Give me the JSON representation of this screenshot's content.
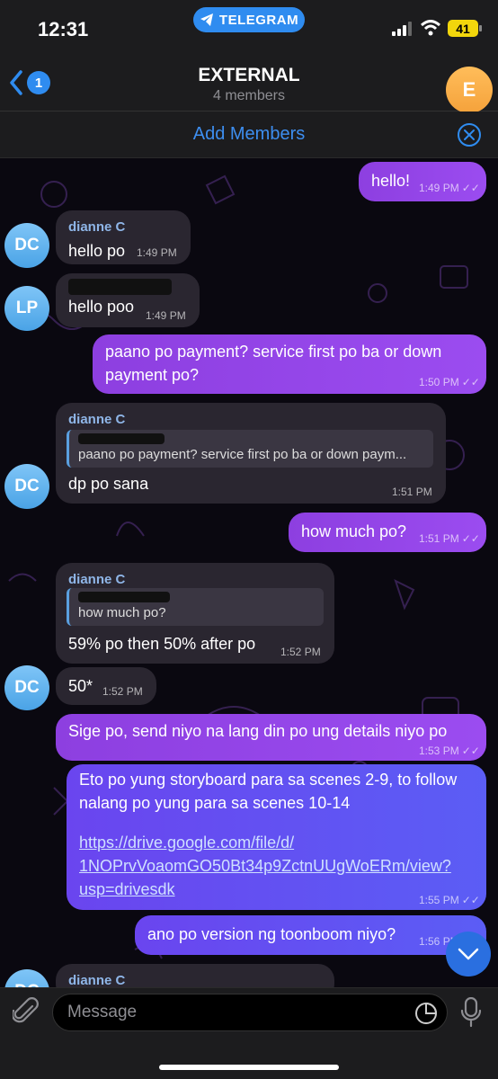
{
  "status_bar": {
    "time": "12:31",
    "app_pill": "TELEGRAM",
    "battery": "41"
  },
  "header": {
    "back_count": "1",
    "title": "EXTERNAL",
    "subtitle": "4 members",
    "avatar_letter": "E"
  },
  "add_members": {
    "label": "Add Members"
  },
  "messages": [
    {
      "text": "hello!",
      "time": "1:49 PM"
    },
    {
      "sender": "dianne C",
      "text": "hello po",
      "time": "1:49 PM",
      "avatar": "DC"
    },
    {
      "text": "hello poo",
      "time": "1:49 PM",
      "avatar": "LP"
    },
    {
      "text": "paano po payment? service first po ba or down payment po?",
      "time": "1:50 PM"
    },
    {
      "sender": "dianne C",
      "reply": "paano po payment? service first po ba or down paym...",
      "text": "dp po sana",
      "time": "1:51 PM",
      "avatar": "DC"
    },
    {
      "text": "how much po?",
      "time": "1:51 PM"
    },
    {
      "sender": "dianne C",
      "reply": "how much po?",
      "text": "59% po then 50% after po",
      "time": "1:52 PM"
    },
    {
      "text": "50*",
      "time": "1:52 PM",
      "avatar": "DC"
    },
    {
      "text": "Sige po, send niyo na lang din po ung details niyo po",
      "time": "1:53 PM"
    },
    {
      "text": "Eto po yung storyboard para sa scenes 2-9, to follow nalang po yung para sa scenes 10-14",
      "link": "https://drive.google.com/file/d/1NOPrvVoaomGO50Bt34p9ZctnUUgWoERm/view?usp=drivesdk",
      "link_lines": [
        "https://drive.google.com/file/d/",
        "1NOPrvVoaomGO50Bt34p9ZctnUUgWoERm/view?",
        "usp=drivesdk"
      ],
      "time": "1:55 PM"
    },
    {
      "text": "ano po version ng toonboom niyo?",
      "time": "1:56 PM"
    },
    {
      "sender": "dianne C",
      "avatar": "DC"
    }
  ],
  "input": {
    "placeholder": "Message"
  },
  "colors": {
    "accent": "#2f8cf0",
    "outgoing": "#9b4cf0",
    "incoming": "#2a2630",
    "sender_name": "#8fb6e8"
  },
  "icons": [
    "telegram-icon",
    "signal-icon",
    "wifi-icon",
    "back-chevron-icon",
    "close-circle-icon",
    "double-check-icon",
    "chevron-down-icon",
    "paperclip-icon",
    "sticker-icon",
    "microphone-icon"
  ]
}
